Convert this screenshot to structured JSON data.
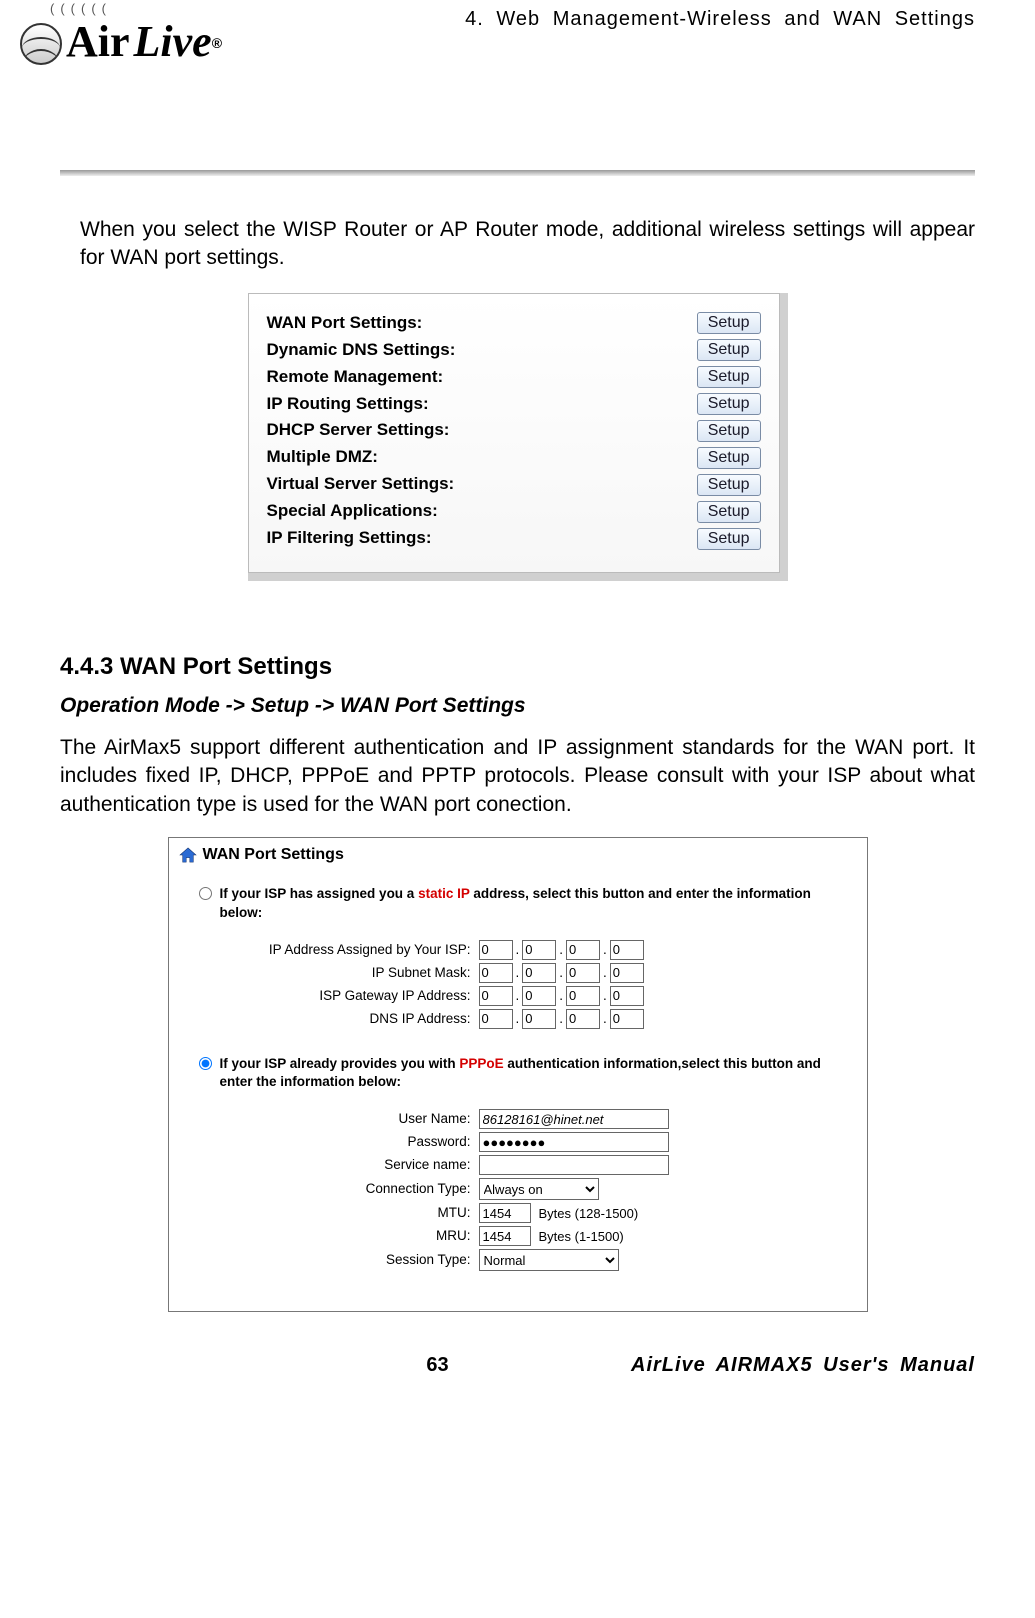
{
  "header": {
    "chapter": "4. Web Management-Wireless and WAN Settings",
    "logo_top_wave": "((((((",
    "logo_air": "Air",
    "logo_live": "Live",
    "logo_tm": "®"
  },
  "intro": "When you select the WISP Router or AP Router mode, additional wireless settings will appear for WAN port settings.",
  "settings_list": {
    "setup_label": "Setup",
    "items": [
      {
        "label": "WAN Port Settings:"
      },
      {
        "label": "Dynamic DNS Settings:"
      },
      {
        "label": "Remote Management:"
      },
      {
        "label": "IP Routing Settings:"
      },
      {
        "label": "DHCP Server Settings:"
      },
      {
        "label": "Multiple DMZ:"
      },
      {
        "label": "Virtual Server Settings:"
      },
      {
        "label": "Special Applications:"
      },
      {
        "label": "IP Filtering Settings:"
      }
    ]
  },
  "section": {
    "heading": "4.4.3 WAN Port Settings",
    "path": "Operation Mode -> Setup -> WAN Port Settings",
    "body": "The AirMax5 support different authentication and IP assignment standards for the WAN port.   It includes fixed IP, DHCP, PPPoE and PPTP protocols.   Please consult with your ISP about what authentication type is used for the WAN port conection."
  },
  "wan": {
    "title": "WAN Port Settings",
    "static": {
      "prefix": "If your ISP has assigned you a ",
      "highlight": "static IP",
      "suffix": " address, select this button and enter the information below:",
      "selected": false,
      "fields": {
        "ip_assigned": {
          "label": "IP Address Assigned by Your ISP:",
          "a": "0",
          "b": "0",
          "c": "0",
          "d": "0"
        },
        "subnet": {
          "label": "IP Subnet Mask:",
          "a": "0",
          "b": "0",
          "c": "0",
          "d": "0"
        },
        "gateway": {
          "label": "ISP Gateway IP Address:",
          "a": "0",
          "b": "0",
          "c": "0",
          "d": "0"
        },
        "dns": {
          "label": "DNS IP Address:",
          "a": "0",
          "b": "0",
          "c": "0",
          "d": "0"
        }
      }
    },
    "pppoe": {
      "prefix": "If your ISP already provides you with ",
      "highlight": "PPPoE",
      "suffix": " authentication information,select this button and enter the information below:",
      "selected": true,
      "fields": {
        "user": {
          "label": "User Name:",
          "value": "86128161@hinet.net"
        },
        "pass": {
          "label": "Password:",
          "value": "●●●●●●●●"
        },
        "service": {
          "label": "Service name:",
          "value": ""
        },
        "conn": {
          "label": "Connection Type:",
          "value": "Always on"
        },
        "mtu": {
          "label": "MTU:",
          "value": "1454",
          "hint": "Bytes (128-1500)"
        },
        "mru": {
          "label": "MRU:",
          "value": "1454",
          "hint": "Bytes (1-1500)"
        },
        "session": {
          "label": "Session Type:",
          "value": "Normal"
        }
      }
    }
  },
  "footer": {
    "page": "63",
    "manual": "AirLive AIRMAX5 User's Manual"
  }
}
